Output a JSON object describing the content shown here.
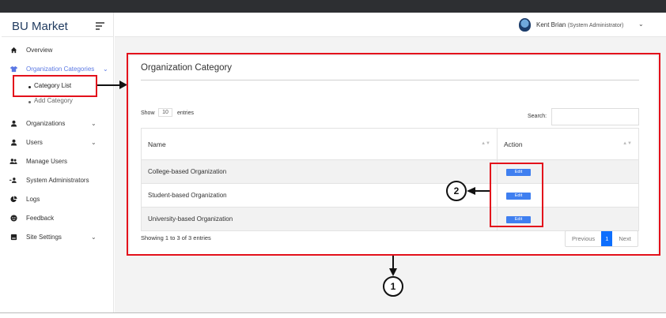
{
  "app": {
    "brand": "BU Market"
  },
  "header": {
    "user_name": "Kent Brian",
    "user_role": "(System Administrator)"
  },
  "sidebar": {
    "items": [
      {
        "label": "Overview",
        "icon": "home-icon"
      },
      {
        "label": "Organization Categories",
        "icon": "shirt-icon",
        "active": true
      },
      {
        "label": "Organizations",
        "icon": "person-icon"
      },
      {
        "label": "Users",
        "icon": "person-icon"
      },
      {
        "label": "Manage Users",
        "icon": "people-icon"
      },
      {
        "label": "System Administrators",
        "icon": "user-gear-icon"
      },
      {
        "label": "Logs",
        "icon": "pie-chart-icon"
      },
      {
        "label": "Feedback",
        "icon": "smile-icon"
      },
      {
        "label": "Site Settings",
        "icon": "settings-icon"
      }
    ],
    "subitems": [
      {
        "label": "Category List"
      },
      {
        "label": "Add Category"
      }
    ]
  },
  "main": {
    "title": "Organization Category",
    "show_label": "Show",
    "show_value": "10",
    "entries_label": "entries",
    "search_label": "Search:",
    "search_value": "",
    "columns": [
      "Name",
      "Action"
    ],
    "rows": [
      {
        "name": "College-based Organization",
        "action": "Edit"
      },
      {
        "name": "Student-based Organization",
        "action": "Edit"
      },
      {
        "name": "University-based Organization",
        "action": "Edit"
      }
    ],
    "info": "Showing 1 to 3 of 3 entries",
    "pagination": {
      "previous": "Previous",
      "current": "1",
      "next": "Next"
    }
  },
  "annotations": {
    "callout_1": "1",
    "callout_2": "2",
    "highlight_color": "#e3101b"
  }
}
